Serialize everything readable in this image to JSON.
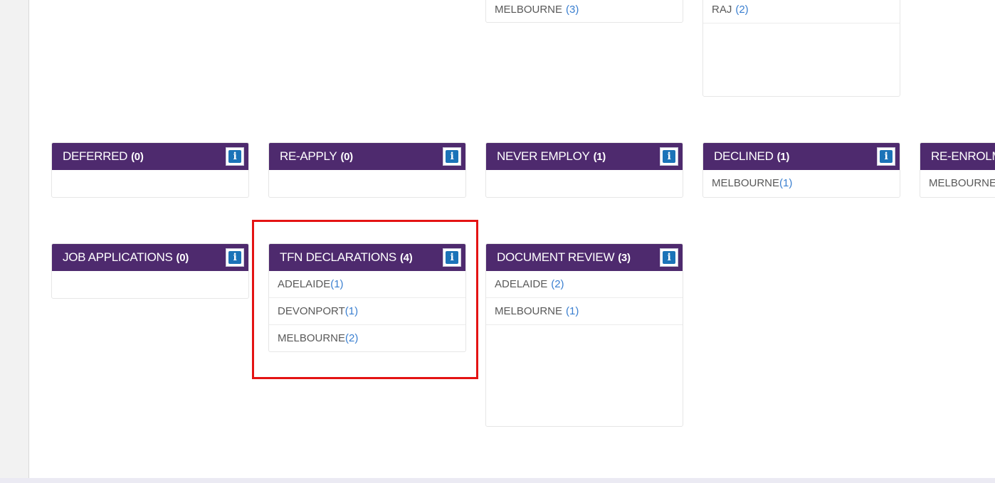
{
  "top_row": {
    "card_a": {
      "rows": [
        {
          "label": "MELBOURNE",
          "count": "(3)"
        }
      ]
    },
    "card_b": {
      "rows": [
        {
          "label": "RAJ",
          "count": "(2)"
        }
      ]
    }
  },
  "middle_row": [
    {
      "title": "DEFERRED",
      "count": "(0)",
      "rows": []
    },
    {
      "title": "RE-APPLY",
      "count": "(0)",
      "rows": []
    },
    {
      "title": "NEVER EMPLOY",
      "count": "(1)",
      "rows": []
    },
    {
      "title": "DECLINED",
      "count": "(1)",
      "rows": [
        {
          "label": "MELBOURNE",
          "count": "(1)"
        }
      ]
    },
    {
      "title": "RE-ENROLM",
      "count": "",
      "rows": [
        {
          "label": "MELBOURNE",
          "count": ""
        }
      ]
    }
  ],
  "bottom_row": [
    {
      "title": "JOB APPLICATIONS",
      "count": "(0)",
      "rows": []
    },
    {
      "title": "TFN DECLARATIONS",
      "count": "(4)",
      "rows": [
        {
          "label": "ADELAIDE",
          "count": "(1)"
        },
        {
          "label": "DEVONPORT",
          "count": "(1)"
        },
        {
          "label": "MELBOURNE",
          "count": "(2)"
        }
      ]
    },
    {
      "title": "DOCUMENT REVIEW",
      "count": "(3)",
      "rows": [
        {
          "label": "ADELAIDE",
          "count": "(2)"
        },
        {
          "label": "MELBOURNE",
          "count": "(1)"
        }
      ]
    }
  ],
  "icons": {
    "info": "info-icon"
  },
  "info_glyph": "i",
  "colors": {
    "header": "#4e2a6e",
    "count_link": "#3a7fd0",
    "highlight": "#e41313",
    "info_blue": "#1b73b8"
  }
}
